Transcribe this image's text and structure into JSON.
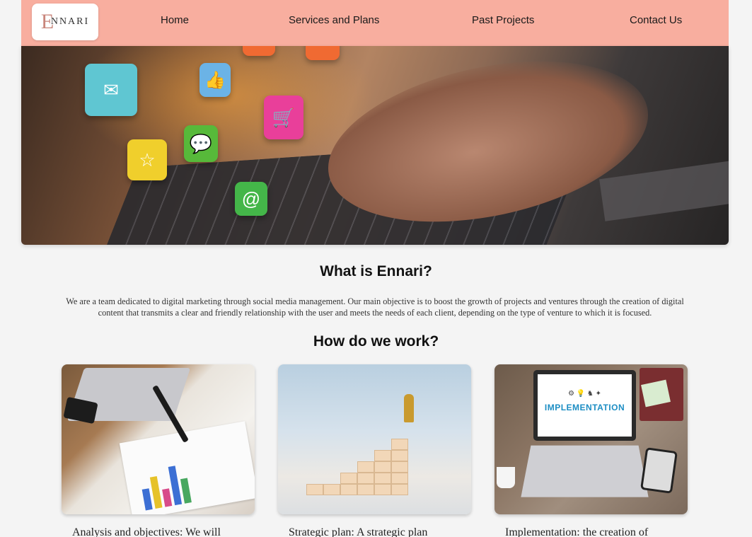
{
  "brand": {
    "logo_text": "NNARI",
    "logo_initial": "E"
  },
  "nav": {
    "home": "Home",
    "services": "Services and Plans",
    "projects": "Past Projects",
    "contact": "Contact Us"
  },
  "hero": {
    "icons": [
      "mail-icon",
      "thumbs-up-icon",
      "shopping-cart-icon",
      "chat-icon",
      "star-icon",
      "at-sign-icon"
    ],
    "accent_colors": {
      "mail": "#5fc6d2",
      "like": "#6bb3e6",
      "cart": "#e93f9a",
      "chat": "#57b93a",
      "star": "#f0cf2c",
      "at": "#44b649"
    }
  },
  "about": {
    "title": "What is Ennari?",
    "body": "We are a team dedicated to digital marketing through social media management. Our main objective is to boost the growth of projects and ventures through the creation of digital content that transmits a clear and friendly relationship with the user and meets the needs of each client, depending on the type of venture to which it is focused."
  },
  "work": {
    "title": "How do we work?",
    "cards": [
      {
        "caption": "Analysis and objectives: We will",
        "image": "analysis-photo"
      },
      {
        "caption": "Strategic plan: A strategic plan",
        "image": "strategy-photo"
      },
      {
        "caption": "Implementation: the creation of",
        "image": "implementation-photo",
        "screen_text": "IMPLEMENTATION"
      }
    ]
  },
  "colors": {
    "header_bg": "#f8ae9f",
    "page_bg": "#f4f4f4"
  }
}
